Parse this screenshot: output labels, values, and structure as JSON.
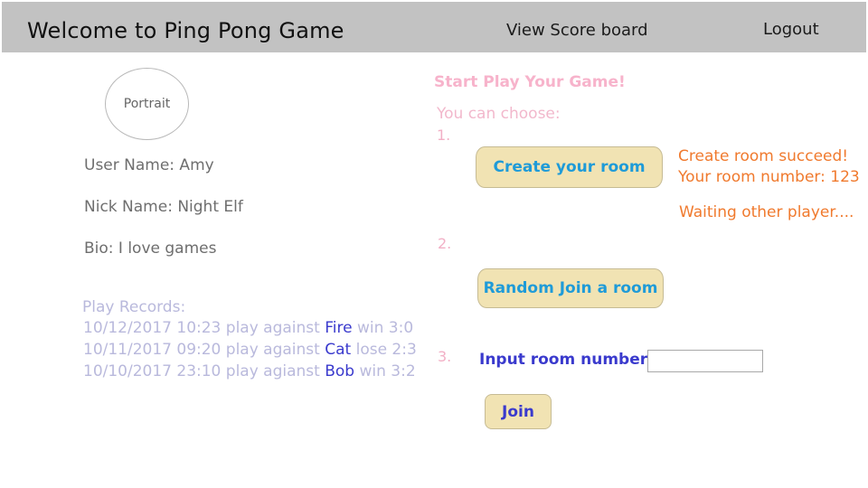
{
  "header": {
    "title": "Welcome to Ping Pong Game",
    "scoreboard_link": "View Score board",
    "logout_link": "Logout"
  },
  "profile": {
    "portrait_label": "Portrait",
    "user_name": "User Name: Amy",
    "nick_name": "Nick Name: Night Elf",
    "bio": "Bio: I love games"
  },
  "records": {
    "title": "Play Records:",
    "items": [
      {
        "prefix": "10/12/2017 10:23 play against ",
        "opponent": "Fire",
        "result": " win 3:0"
      },
      {
        "prefix": "10/11/2017 09:20 play against ",
        "opponent": "Cat",
        "result": " lose 2:3"
      },
      {
        "prefix": "10/10/2017 23:10 play agianst ",
        "opponent": "Bob",
        "result": " win 3:2"
      }
    ]
  },
  "game": {
    "title": "Start Play Your Game!",
    "choose_label": "You can choose:",
    "steps": [
      "1.",
      "2.",
      "3."
    ],
    "create_button": "Create your room",
    "random_button": "Random Join a room",
    "input_label": "Input room number:",
    "room_input_value": "",
    "room_input_placeholder": "",
    "join_button": "Join",
    "status": {
      "line1": "Create room succeed!",
      "line2": "Your room number: 123",
      "line3": "Waiting  other player...."
    }
  },
  "colors": {
    "header_bg": "#c2c2c2",
    "button_bg": "#f1e3b3",
    "accent_blue": "#1f9bd8",
    "accent_indigo": "#3a3acd",
    "status_orange": "#f07a2e",
    "pink": "#f7b3cb"
  }
}
